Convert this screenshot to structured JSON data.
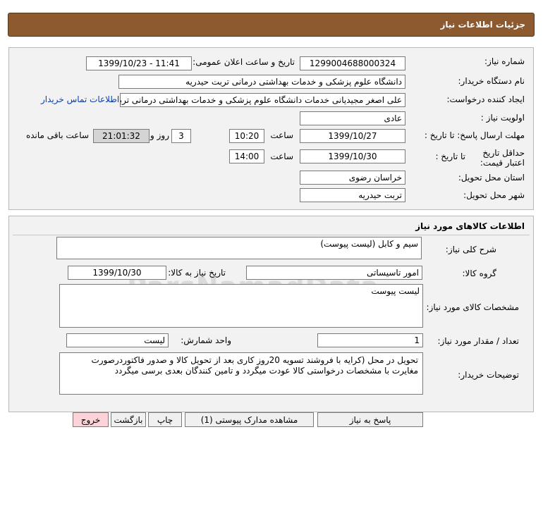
{
  "header": {
    "title": "جزئیات اطلاعات نیاز"
  },
  "info": {
    "need_number_label": "شماره نیاز:",
    "need_number": "1299004688000324",
    "announce_label": "تاریخ و ساعت اعلان عمومی:",
    "announce_value": "1399/10/23 - 11:41",
    "buyer_org_label": "نام دستگاه خریدار:",
    "buyer_org": "دانشگاه علوم پزشکی و خدمات بهداشتی درمانی تربت حیدریه",
    "creator_label": "ایجاد کننده درخواست:",
    "creator": "علی اصغر مجیدیانی خدمات دانشگاه علوم پزشکی و خدمات بهداشتی درمانی تربت",
    "contact_link": "اطلاعات تماس خریدار",
    "priority_label": "اولویت نیاز :",
    "priority": "عادی",
    "deadline_label": "مهلت ارسال پاسخ: تا تاریخ :",
    "deadline_date": "1399/10/27",
    "time_label": "ساعت",
    "deadline_time": "10:20",
    "days_value": "3",
    "days_label": "روز و",
    "remaining_time": "21:01:32",
    "remaining_label": "ساعت باقی مانده",
    "validity_label": "حداقل تاریخ اعتبار قیمت:",
    "validity_to_label": "تا تاریخ :",
    "validity_date": "1399/10/30",
    "validity_time_label": "ساعت",
    "validity_time": "14:00",
    "province_label": "استان محل تحویل:",
    "province": "خراسان رضوی",
    "city_label": "شهر محل تحویل:",
    "city": "تربت حیدریه"
  },
  "goods": {
    "section_title": "اطلاعات کالاهای مورد نیاز",
    "desc_label": "شرح کلی نیاز:",
    "desc": "سیم و کابل (لیست پیوست)",
    "group_label": "گروه کالا:",
    "group": "امور تاسیساتی",
    "need_date_label": "تاریخ نیاز به کالا:",
    "need_date": "1399/10/30",
    "specs_label": "مشخصات کالای مورد نیاز:",
    "specs": "لیست پیوست",
    "qty_label": "تعداد / مقدار مورد نیاز:",
    "qty": "1",
    "unit_label": "واحد شمارش:",
    "unit": "لیست",
    "notes_label": "توضیحات خریدار:",
    "notes": "تحویل در محل (کرایه با فروشند تسویه 20روز کاری بعد از تحویل کالا و صدور فاکتوردرصورت مغایرت با مشخصات درخواستی  کالا عودت میگردد و تامین کنندگان بعدی برسی میگردد"
  },
  "watermark": "ParsNamadData",
  "buttons": {
    "reply": "پاسخ به نیاز",
    "attachments": "مشاهده مدارک پیوستی (1)",
    "print": "چاپ",
    "back": "بازگشت",
    "exit": "خروج"
  }
}
